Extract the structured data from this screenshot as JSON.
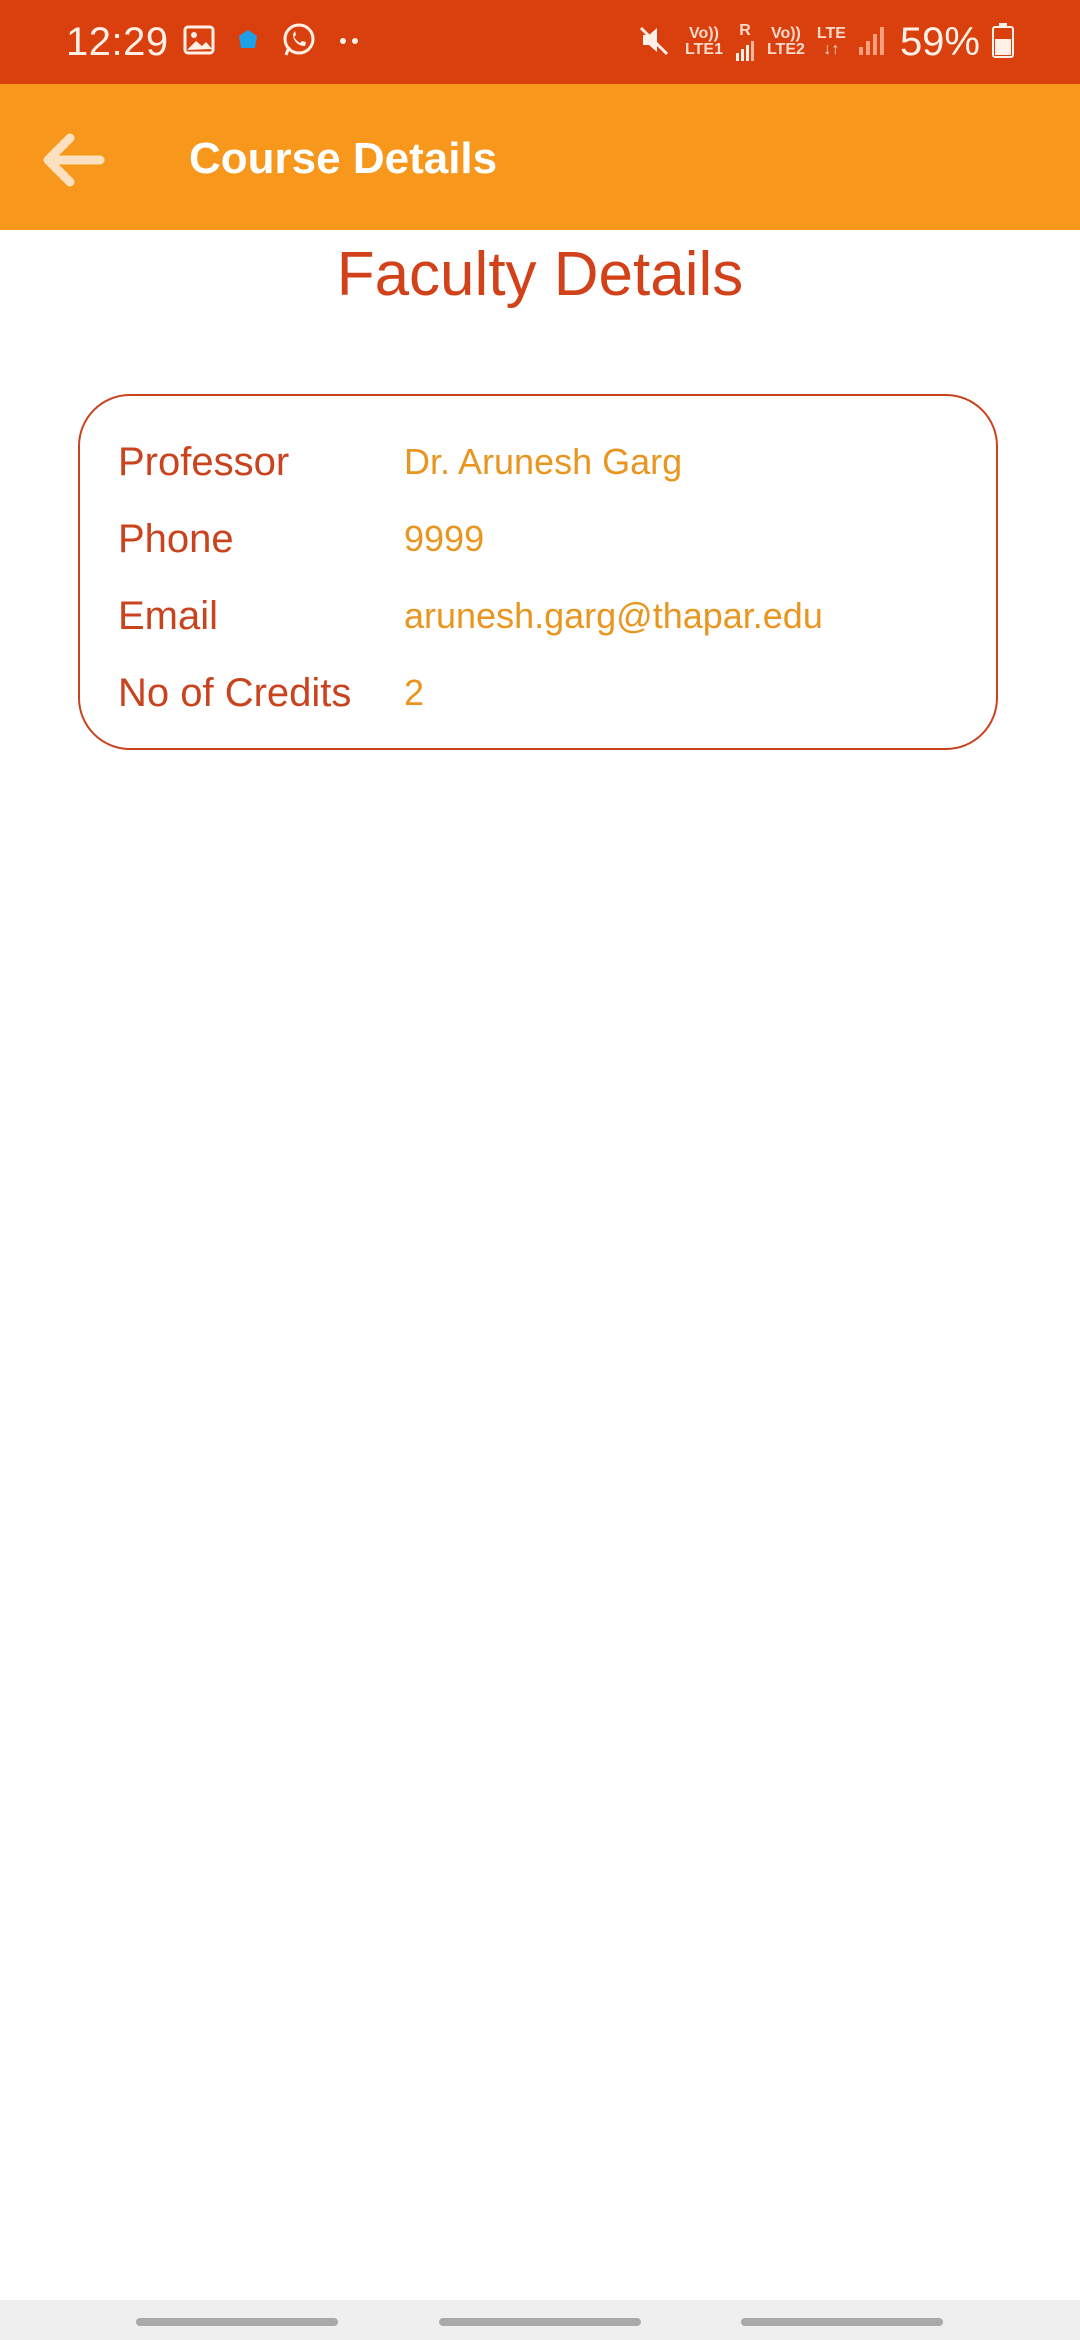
{
  "status_bar": {
    "time": "12:29",
    "left_icons": [
      "gallery-icon",
      "notification-dot-icon",
      "whatsapp-icon",
      "more-dots-icon"
    ],
    "sim1": {
      "volte": "Vo))",
      "network": "LTE1",
      "roaming": "R"
    },
    "sim2": {
      "volte": "Vo))",
      "network": "LTE2",
      "data": "LTE"
    },
    "battery_percent": "59%",
    "colors": {
      "background": "#d9400d",
      "text": "#fff1e8"
    }
  },
  "app_bar": {
    "title": "Course Details",
    "back_icon": "arrow-left-icon",
    "color": "#f7981c"
  },
  "page": {
    "heading": "Faculty Details"
  },
  "faculty": {
    "rows": [
      {
        "label": "Professor",
        "value": "Dr. Arunesh Garg"
      },
      {
        "label": "Phone",
        "value": "9999"
      },
      {
        "label": "Email",
        "value": "arunesh.garg@thapar.edu"
      },
      {
        "label": "No of Credits",
        "value": "2"
      }
    ],
    "colors": {
      "label": "#c8431e",
      "value": "#e8961f",
      "border": "#c8431e"
    }
  },
  "nav_bar": {
    "handles": 3
  }
}
